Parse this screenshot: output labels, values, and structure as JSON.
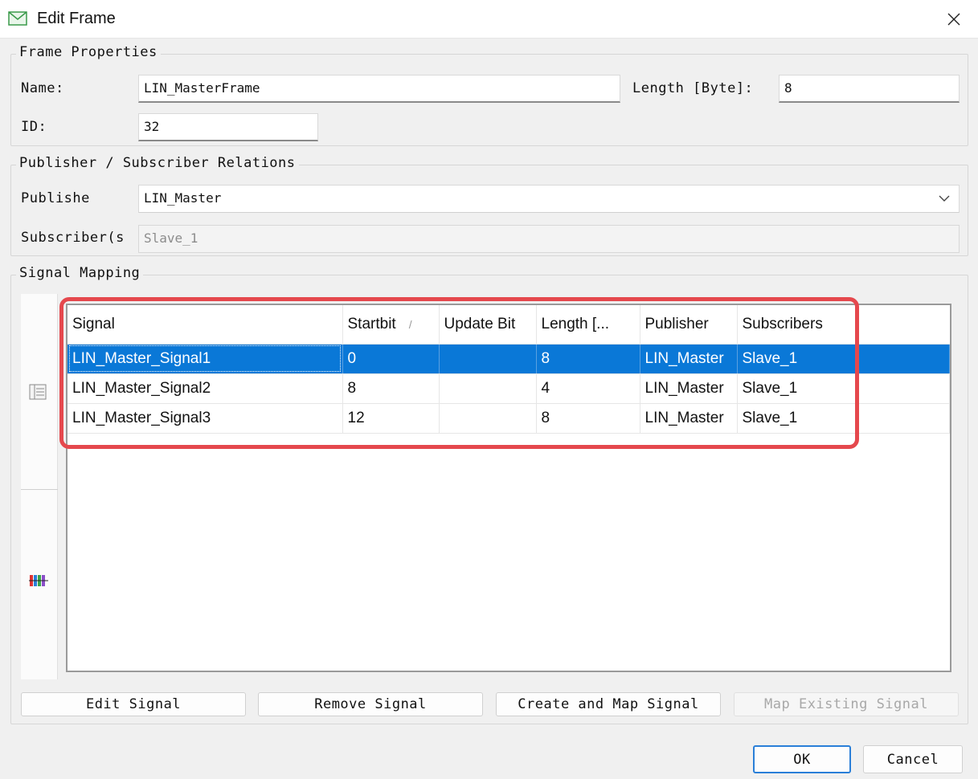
{
  "window": {
    "title": "Edit Frame"
  },
  "frame_properties": {
    "group_label": "Frame Properties",
    "name_label": "Name:",
    "name_value": "LIN_MasterFrame",
    "length_label": "Length [Byte]:",
    "length_value": "8",
    "id_label": "ID:",
    "id_value": "32"
  },
  "relations": {
    "group_label": "Publisher / Subscriber Relations",
    "publisher_label": "Publishe",
    "publisher_value": "LIN_Master",
    "subscribers_label": "Subscriber(s",
    "subscribers_value": "Slave_1"
  },
  "signal_mapping": {
    "group_label": "Signal Mapping",
    "columns": [
      "Signal",
      "Startbit",
      "Update Bit",
      "Length [...",
      "Publisher",
      "Subscribers"
    ],
    "sort_indicator": "/",
    "rows": [
      {
        "signal": "LIN_Master_Signal1",
        "startbit": "0",
        "update_bit": "",
        "length": "8",
        "publisher": "LIN_Master",
        "subscribers": "Slave_1",
        "selected": true
      },
      {
        "signal": "LIN_Master_Signal2",
        "startbit": "8",
        "update_bit": "",
        "length": "4",
        "publisher": "LIN_Master",
        "subscribers": "Slave_1",
        "selected": false
      },
      {
        "signal": "LIN_Master_Signal3",
        "startbit": "12",
        "update_bit": "",
        "length": "8",
        "publisher": "LIN_Master",
        "subscribers": "Slave_1",
        "selected": false
      }
    ]
  },
  "buttons": {
    "edit_signal": "Edit Signal",
    "remove_signal": "Remove Signal",
    "create_map_signal": "Create and Map Signal",
    "map_existing_signal": "Map Existing Signal",
    "ok": "OK",
    "cancel": "Cancel"
  },
  "colors": {
    "selection": "#0a78d7",
    "highlight": "#e5484d",
    "primary_border": "#2a7fd8"
  }
}
